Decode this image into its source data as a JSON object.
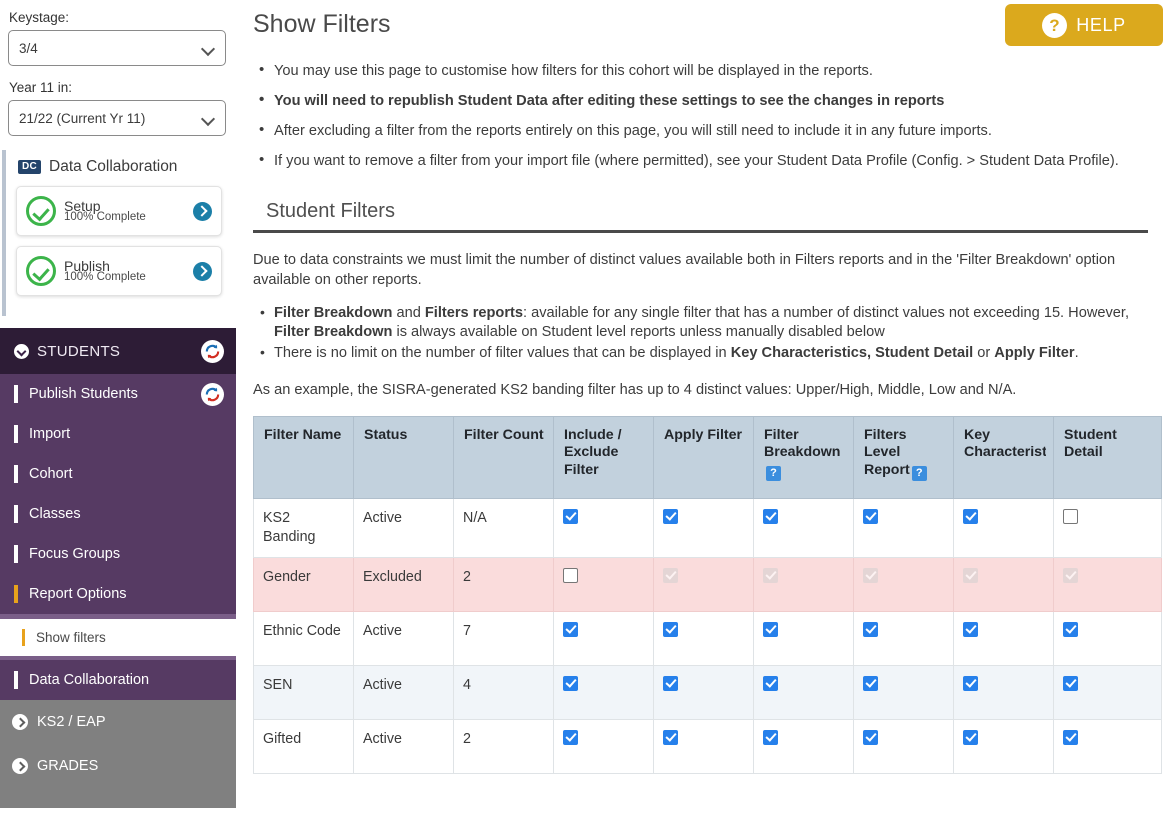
{
  "sidebar": {
    "keystage": {
      "label": "Keystage:",
      "value": "3/4"
    },
    "year": {
      "label": "Year 11 in:",
      "value": "21/22 (Current Yr 11)"
    },
    "data_collaboration": {
      "badge": "DC",
      "title": "Data Collaboration",
      "cards": [
        {
          "title": "Setup",
          "status": "100% Complete",
          "arrow_icon": "chevron-right-circle-icon"
        },
        {
          "title": "Publish",
          "status": "100% Complete",
          "arrow_icon": "chevron-right-circle-icon"
        }
      ]
    },
    "nav": {
      "header": {
        "label": "STUDENTS",
        "expand_icon": "chevron-down-circle-icon",
        "action_icon": "refresh-icon"
      },
      "items": [
        {
          "label": "Publish Students",
          "action_icon": "refresh-icon"
        },
        {
          "label": "Import"
        },
        {
          "label": "Cohort"
        },
        {
          "label": "Classes"
        },
        {
          "label": "Focus Groups"
        },
        {
          "label": "Report Options",
          "active": true
        }
      ],
      "sub_item": {
        "label": "Show filters"
      },
      "trailing_item": {
        "label": "Data Collaboration"
      },
      "sections": [
        {
          "label": "KS2 / EAP",
          "icon": "chevron-right-circle-icon"
        },
        {
          "label": "GRADES",
          "icon": "chevron-right-circle-icon"
        }
      ]
    }
  },
  "main": {
    "page_title": "Show Filters",
    "help_button": {
      "label": "HELP",
      "icon": "question-mark-icon"
    },
    "intro_bullets": [
      {
        "text": "You may use this page to customise how filters for this cohort will be displayed in the reports.",
        "bold": false
      },
      {
        "text": "You will need to republish Student Data after editing these settings to see the changes in reports",
        "bold": true
      },
      {
        "text": "After excluding a filter from the reports entirely on this page, you will still need to include it in any future imports.",
        "bold": false
      },
      {
        "text": "If you want to remove a filter from your import file (where permitted), see your Student Data Profile (Config. > Student Data Profile).",
        "bold": false
      }
    ],
    "section_title": "Student Filters",
    "paragraph": "Due to data constraints we must limit the number of distinct values available both in Filters reports and in the 'Filter Breakdown' option available on other reports.",
    "sub_bullets": [
      "Filter Breakdown and Filters reports: available for any single filter that has a number of distinct values not exceeding 15. However, Filter Breakdown is always available on Student level reports unless manually disabled below",
      "There is no limit on the number of filter values that can be displayed in Key Characteristics, Student Detail or Apply Filter."
    ],
    "example_paragraph": "As an example, the SISRA-generated KS2 banding filter has up to 4 distinct values: Upper/High, Middle, Low and N/A.",
    "table": {
      "columns": [
        {
          "label": "Filter Name",
          "help": false
        },
        {
          "label": "Status",
          "help": false
        },
        {
          "label": "Filter Count",
          "help": false
        },
        {
          "label": "Include / Exclude Filter",
          "help": false
        },
        {
          "label": "Apply Filter",
          "help": false
        },
        {
          "label": "Filter Breakdown",
          "help": true,
          "help_label": "?"
        },
        {
          "label": "Filters Level Report",
          "help": true,
          "help_label": "?"
        },
        {
          "label": "Key Characteristics",
          "help": false
        },
        {
          "label": "Student Detail",
          "help": false
        }
      ],
      "rows": [
        {
          "name": "KS2 Banding",
          "status": "Active",
          "count": "N/A",
          "include_exclude": "checked",
          "apply_filter": "checked",
          "filter_breakdown": "checked",
          "filters_level_report": "checked",
          "key_characteristics": "checked",
          "student_detail": "unchecked",
          "style": "white"
        },
        {
          "name": "Gender",
          "status": "Excluded",
          "count": "2",
          "include_exclude": "unchecked",
          "apply_filter": "disabled",
          "filter_breakdown": "disabled",
          "filters_level_report": "disabled",
          "key_characteristics": "disabled",
          "student_detail": "disabled",
          "style": "excluded"
        },
        {
          "name": "Ethnic Code",
          "status": "Active",
          "count": "7",
          "include_exclude": "checked",
          "apply_filter": "checked",
          "filter_breakdown": "checked",
          "filters_level_report": "checked",
          "key_characteristics": "checked",
          "student_detail": "checked",
          "style": "white"
        },
        {
          "name": "SEN",
          "status": "Active",
          "count": "4",
          "include_exclude": "checked",
          "apply_filter": "checked",
          "filter_breakdown": "checked",
          "filters_level_report": "checked",
          "key_characteristics": "checked",
          "student_detail": "checked",
          "style": "alt"
        },
        {
          "name": "Gifted",
          "status": "Active",
          "count": "2",
          "include_exclude": "checked",
          "apply_filter": "checked",
          "filter_breakdown": "checked",
          "filters_level_report": "checked",
          "key_characteristics": "checked",
          "student_detail": "checked",
          "style": "white"
        }
      ]
    }
  },
  "colors": {
    "accent_gold": "#dba91d",
    "nav_purple": "#563a63",
    "nav_purple_dark": "#2d1c36",
    "table_header": "#c2d1dd",
    "excluded_row": "#fadcdc",
    "checkbox_blue": "#2680eb",
    "badge_navy": "#24446b",
    "complete_green": "#3cb44a"
  }
}
